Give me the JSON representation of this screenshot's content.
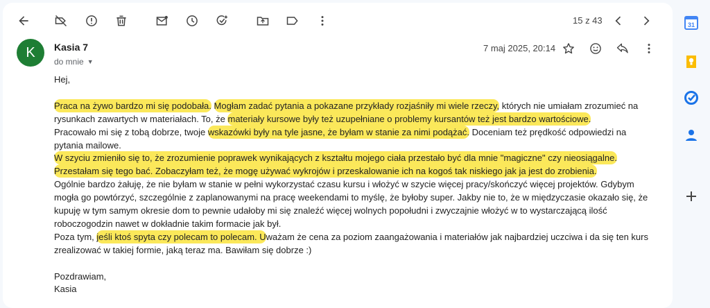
{
  "toolbar": {
    "counter": "15 z 43",
    "icons": [
      "back-arrow-icon",
      "label-off-icon",
      "report-spam-icon",
      "delete-icon",
      "mark-unread-icon",
      "snooze-icon",
      "add-task-icon",
      "move-to-icon",
      "label-icon",
      "more-icon",
      "prev-icon",
      "next-icon"
    ]
  },
  "header": {
    "avatar_letter": "K",
    "sender_name": "Kasia 7",
    "sender_email": "",
    "recipient": "do mnie",
    "date": "7 maj 2025, 20:14"
  },
  "body": {
    "greeting": "Hej,",
    "p1": [
      {
        "t": "Praca na żywo bardzo mi się podobała.",
        "hl": true
      },
      {
        "t": " ",
        "hl": false
      },
      {
        "t": "Mogłam zadać pytania a pokazane przykłady rozjaśniły mi wiele rzeczy,",
        "hl": true
      },
      {
        "t": " których nie umiałam zrozumieć na rysunkach zawartych w materiałach. To, że ",
        "hl": false
      },
      {
        "t": "materiały kursowe były też uzupełniane o problemy kursantów też jest bardzo wartościowe.",
        "hl": true
      }
    ],
    "p2": [
      {
        "t": "Pracowało mi się z tobą dobrze, twoje ",
        "hl": false
      },
      {
        "t": "wskazówki były na tyle jasne, że byłam w stanie za nimi podążać.",
        "hl": true
      },
      {
        "t": " Doceniam też prędkość odpowiedzi na pytania mailowe.",
        "hl": false
      }
    ],
    "p3": [
      {
        "t": "W szyciu zmieniło się to, że zrozumienie poprawek wynikających z kształtu mojego ciała przestało być dla mnie \"magiczne\" czy nieosiągalne. Przestałam się tego bać. Zobaczyłam też, że mogę używać wykrojów i przeskalowanie ich na kogoś tak niskiego jak ja jest do zrobienia.",
        "hl": true
      }
    ],
    "p4": [
      {
        "t": "Ogólnie bardzo żałuję, że nie byłam w stanie w pełni wykorzystać czasu kursu i włożyć w szycie więcej pracy/skończyć więcej projektów. Gdybym mogła go powtórzyć, szczególnie z zaplanowanymi na pracę weekendami to myślę, że byłoby super. Jakby nie to, że w międzyczasie okazało się, że kupuję w tym samym okresie dom to pewnie udałoby mi się znaleźć więcej wolnych popołudni i zwyczajnie włożyć w to wystarczającą ilość roboczogodzin nawet w dokładnie takim formacie jak był.",
        "hl": false
      }
    ],
    "p5": [
      {
        "t": "Poza tym, ",
        "hl": false
      },
      {
        "t": "jeśli ktoś spyta czy polecam to polecam. U",
        "hl": true
      },
      {
        "t": "ważam że cena za poziom zaangażowania i materiałów jak najbardziej uczciwa i da się ten kurs zrealizować w takiej formie, jaką teraz ma. Bawiłam się dobrze :)",
        "hl": false
      }
    ],
    "closing": "Pozdrawiam,",
    "signature": "Kasia"
  },
  "side_apps": [
    "calendar-icon",
    "keep-icon",
    "tasks-icon",
    "contacts-icon",
    "add-icon"
  ],
  "colors": {
    "highlight": "#fbe85a",
    "avatar": "#1e7e34",
    "sidebar_bg": "#f5f8fc"
  }
}
